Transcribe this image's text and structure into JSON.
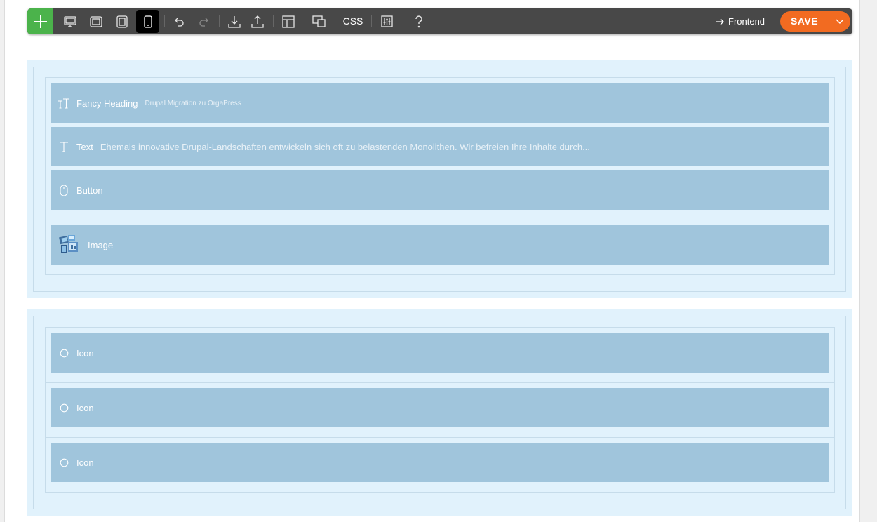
{
  "toolbar": {
    "add_icon": "plus-icon",
    "devices": [
      {
        "name": "desktop-view",
        "icon": "desktop-icon"
      },
      {
        "name": "tablet-landscape-view",
        "icon": "tablet-landscape-icon"
      },
      {
        "name": "tablet-portrait-view",
        "icon": "tablet-portrait-icon"
      },
      {
        "name": "mobile-view",
        "icon": "mobile-icon",
        "active": true
      }
    ],
    "css_label": "CSS",
    "frontend_label": "Frontend",
    "save_label": "SAVE",
    "colors": {
      "bar": "#484848",
      "add": "#4bb34b",
      "save": "#f26b21"
    }
  },
  "sections": [
    {
      "elements": [
        {
          "type": "fancy-heading",
          "icon": "fancy-heading-icon",
          "label": "Fancy Heading",
          "preview": "Drupal Migration zu OrgaPress"
        },
        {
          "type": "text",
          "icon": "text-icon",
          "label": "Text",
          "preview": "Ehemals innovative Drupal-Landschaften entwickeln sich oft zu belastenden Monolithen. Wir befreien Ihre Inhalte durch..."
        },
        {
          "type": "button",
          "icon": "mouse-icon",
          "label": "Button"
        },
        {
          "type": "image",
          "icon": "image-icon",
          "label": "Image"
        }
      ]
    },
    {
      "elements": [
        {
          "type": "icon",
          "icon": "circle-icon",
          "label": "Icon"
        },
        {
          "type": "icon",
          "icon": "circle-icon",
          "label": "Icon"
        },
        {
          "type": "icon",
          "icon": "circle-icon",
          "label": "Icon"
        }
      ]
    }
  ],
  "colors": {
    "section_bg": "#e1f2fc",
    "element_bg": "#a0c5dc",
    "border": "#c6dcea"
  }
}
